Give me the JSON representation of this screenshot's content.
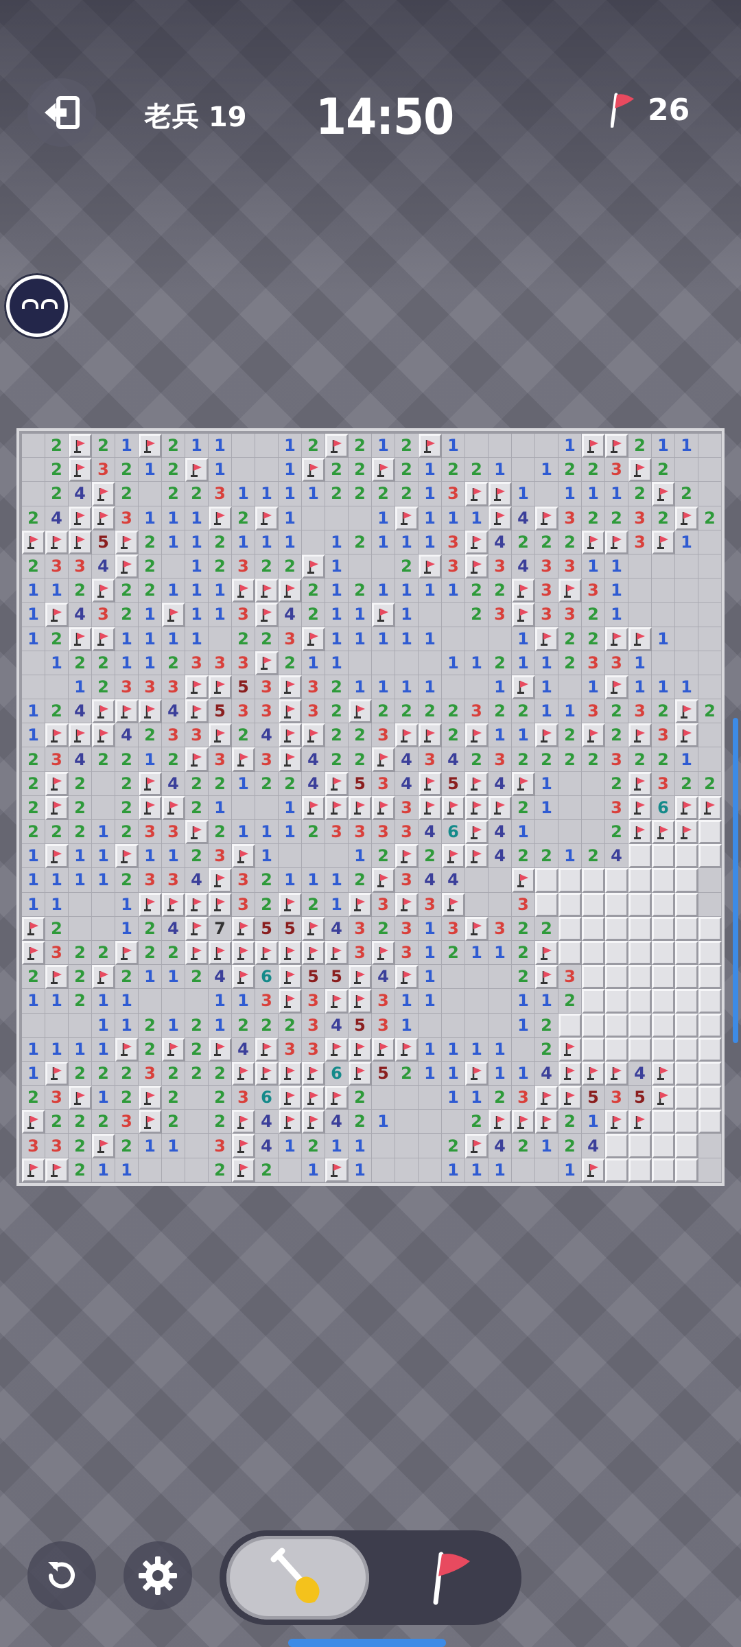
{
  "header": {
    "rank_label": "老兵 19",
    "timer": "14:50",
    "flags_remaining": "26"
  },
  "icons": {
    "exit": "exit-icon",
    "flag": "flag-icon",
    "restart": "restart-icon",
    "settings": "gear-icon",
    "dig": "shovel-icon",
    "flag_mode": "flag-icon"
  },
  "colors": {
    "accent": "#3d8be6",
    "flag": "#e84a5f",
    "number_1": "#2f5bd2",
    "number_2": "#2e9a3a",
    "number_3": "#d9403b",
    "number_4": "#3b3f9a",
    "number_5": "#8a1e1e",
    "number_6": "#148a8a"
  },
  "board": {
    "cols": 30,
    "rows": 31,
    "legend": "Each row string: '.' = revealed empty, digit = revealed count, 'F' = flagged, '#' = unrevealed",
    "cells": [
      ".2F2 1F211..1 2F21 2F1....1FF211",
      ".2F3 212F1..1F2 2F2 122 1.1223F2",
      ".24F2.223111122 2 2 13FF1.1112F2",
      "24FF3111F2F1...1F111F4F32232F2211",
      "FFF5F2112111.121113F4222FF3F1..",
      "233 4F2.1232 2F1..2F3F3 433 11..",
      "112F22111FFF21211112 2F3F31....",
      "1F432 1F113F421 1F1..23F332 1..",
      "12FF1 111.223F1111 1...1F22FF1..",
      ".1221 1233 3F211 ....1121 1233 1",
      "..1233 3FF 5 3F 3 2111 1..1F1.1F111",
      "124FF F4F5 3 3F3 2F2 2 2 2 3 2 2 1 1 3 2 3 2 F 2",
      "1FFF4 2 3 3F2 4 FF2 2 3 F F2 F1 1F 2 F2 F3F",
      "234 2 2 1 2F 3F3F4 2 2F 4 3 4 2 3 2 2 2 2 3 2 2 1",
      "2F2.2F4 2 2 1 2 2 4F5 3 4F5 F4F1..2F3 2 2",
      "2F2.2FF2 1..1FFFF3FFFF2 1..3F6FF",
      "2 2 2 1 2 3 3F2 1 1 1 2 3 3 3 3 4 6F4 1...2FFF#",
      "1F1 1F1 1 2 3F1...1 2F2F F4 2 2 1 2 4####",
      "1111 2 3 3 4F3 2 1 1 1 2F3 4 4..F#######",
      "11..1FFFF3 2F2 1F3F3F..3#######",
      "F2..1 2 4F7F5 5F4 3 2 3 1 3F3 2 2########",
      "F3 2 2F2 2FFFFFFF3F3 1 2 1 1 2F#######",
      "2F2F2 1 1 2 4F6F5 5F4F1...2F3######",
      "1 1 2 1 1...1 1 3F3FF3 1 1...1 1 2#######",
      "...1 1 2 1 2 1 2 2 2 3 4 5 3 1....1 2#######",
      "1 1 1 1F2F2F4F3 3FFFF1 1 1 1.2F#######",
      "1F2 2 2 3 2 2 2FFFF6F5 2 1 1F1 1 4FFF4F###",
      "2 3F1 2F2.2 3 6FFF2...1 1 2 3FF5 3 5F###",
      "F2 2 2 3F2.2F4FF4 2 1...2FFF2 1FF###",
      "3 3 2F2 1 1.3F4 1 2 1 1...2F4 2 1 2 4####",
      "FF2 1 1...2F2.1F1...1 1 1..1F####"
    ]
  }
}
